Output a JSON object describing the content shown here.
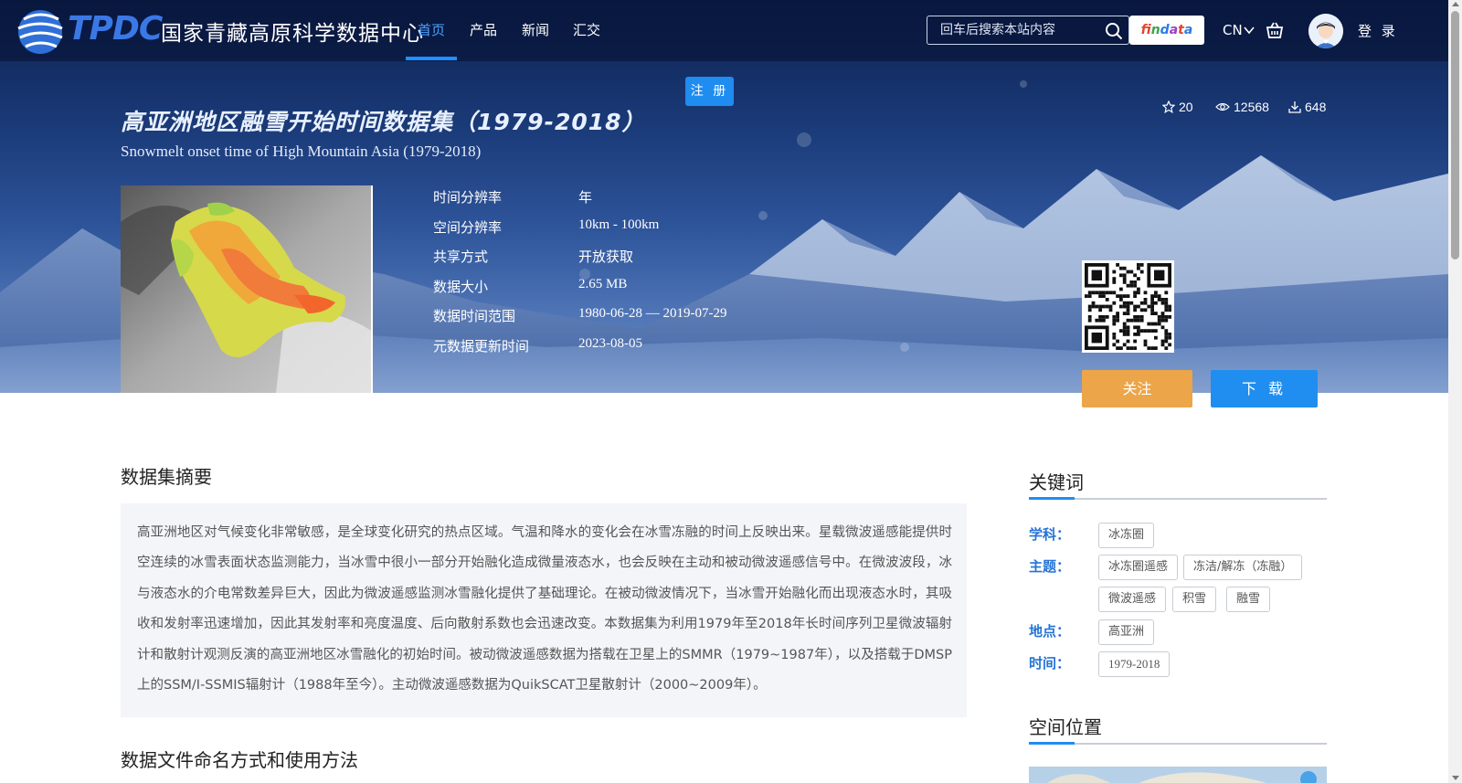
{
  "header": {
    "logo_text": "TPDC",
    "site_name": "国家青藏高原科学数据中心",
    "nav": [
      {
        "label": "首页",
        "active": true
      },
      {
        "label": "产品",
        "active": false
      },
      {
        "label": "新闻",
        "active": false
      },
      {
        "label": "汇交",
        "active": false
      }
    ],
    "search": {
      "placeholder": "回车后搜索本站内容",
      "value": ""
    },
    "findata_label": "findata",
    "lang": "CN",
    "login_label": "登 录",
    "register_label": "注 册"
  },
  "dataset": {
    "title_cn": "高亚洲地区融雪开始时间数据集（1979-2018）",
    "title_en": "Snowmelt onset time of High Mountain Asia (1979-2018)",
    "stats": {
      "favorites": "20",
      "views": "12568",
      "downloads": "648"
    },
    "metadata": [
      {
        "label": "时间分辨率",
        "value": "年"
      },
      {
        "label": "空间分辨率",
        "value": "10km - 100km"
      },
      {
        "label": "共享方式",
        "value": "开放获取"
      },
      {
        "label": "数据大小",
        "value": "2.65 MB"
      },
      {
        "label": "数据时间范围",
        "value": "1980-06-28 — 2019-07-29"
      },
      {
        "label": "元数据更新时间",
        "value": "2023-08-05"
      }
    ],
    "follow_label": "关注",
    "download_label": "下 载"
  },
  "abstract": {
    "heading": "数据集摘要",
    "text": "高亚洲地区对气候变化非常敏感，是全球变化研究的热点区域。气温和降水的变化会在冰雪冻融的时间上反映出来。星载微波遥感能提供时空连续的冰雪表面状态监测能力，当冰雪中很小一部分开始融化造成微量液态水，也会反映在主动和被动微波遥感信号中。在微波波段，冰与液态水的介电常数差异巨大，因此为微波遥感监测冰雪融化提供了基础理论。在被动微波情况下，当冰雪开始融化而出现液态水时，其吸收和发射率迅速增加，因此其发射率和亮度温度、后向散射系数也会迅速改变。本数据集为利用1979年至2018年长时间序列卫星微波辐射计和散射计观测反演的高亚洲地区冰雪融化的初始时间。被动微波遥感数据为搭载在卫星上的SMMR（1979~1987年），以及搭载于DMSP上的SSM/I-SSMIS辐射计（1988年至今）。主动微波遥感数据为QuikSCAT卫星散射计（2000~2009年）。"
  },
  "file_naming": {
    "heading": "数据文件命名方式和使用方法"
  },
  "keywords": {
    "heading": "关键词",
    "groups": [
      {
        "label": "学科：",
        "tags": [
          "冰冻圈"
        ]
      },
      {
        "label": "主题：",
        "tags": [
          "冰冻圈遥感",
          "冻洁/解冻（冻融）",
          "微波遥感",
          "积雪",
          "融雪"
        ]
      },
      {
        "label": "地点：",
        "tags": [
          "高亚洲"
        ]
      },
      {
        "label": "时间：",
        "tags": [
          "1979-2018"
        ]
      }
    ]
  },
  "spatial": {
    "heading": "空间位置"
  },
  "colors": {
    "accent": "#1f8ef0",
    "follow": "#eca548",
    "label_blue": "#2574d6"
  }
}
